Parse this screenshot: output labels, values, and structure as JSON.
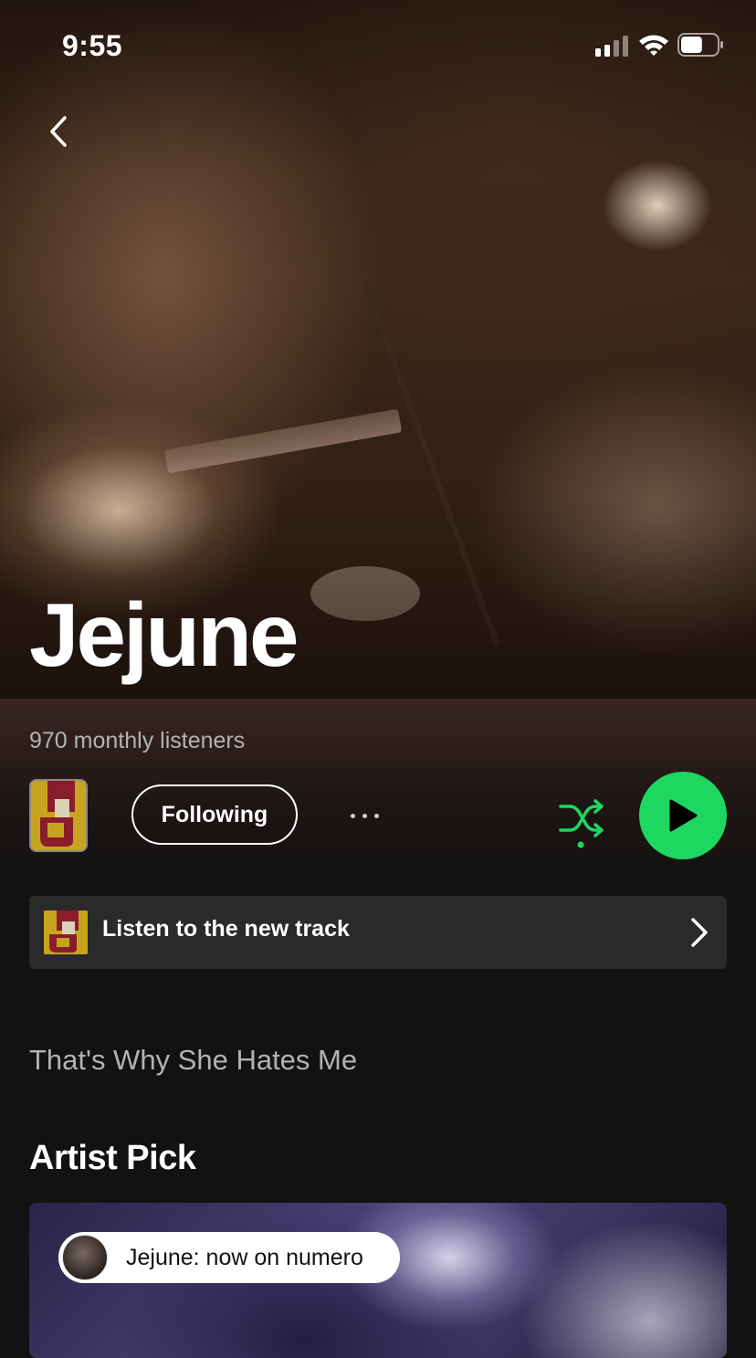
{
  "status_bar": {
    "time": "9:55",
    "battery_level": 0.6
  },
  "artist": {
    "name": "Jejune",
    "monthly_listeners": "970 monthly listeners"
  },
  "actions": {
    "follow_label": "Following"
  },
  "promo": {
    "label": "Listen to the new track"
  },
  "tagline": "That's Why She Hates Me",
  "artist_pick": {
    "section_title": "Artist Pick",
    "pill_label": "Jejune: now on numero"
  },
  "colors": {
    "accent": "#1ed760",
    "background": "#121212",
    "card": "#2a2a2a",
    "secondary_text": "#b3b3b3"
  },
  "icons": [
    "back-icon",
    "signal-icon",
    "wifi-icon",
    "battery-icon",
    "more-icon",
    "shuffle-icon",
    "play-icon",
    "chevron-right-icon"
  ]
}
